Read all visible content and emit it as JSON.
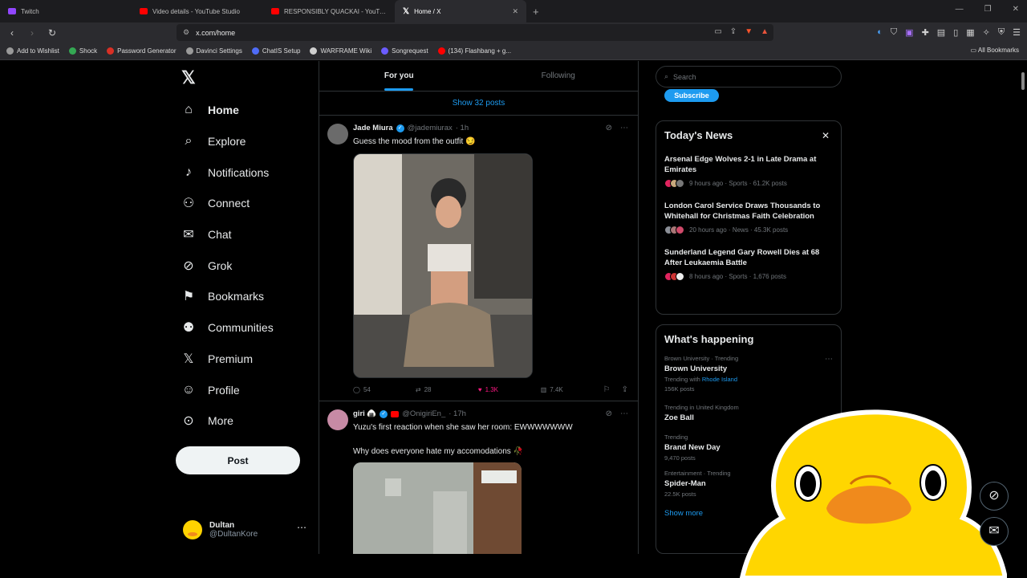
{
  "browser": {
    "tabs": [
      {
        "title": "Twitch",
        "fav_color": "#9146ff",
        "active": false
      },
      {
        "title": "Video details - YouTube Studio",
        "fav_color": "#ff0000",
        "active": false
      },
      {
        "title": "RESPONSIBLY QUACKAI - YouTube",
        "fav_color": "#ff0000",
        "active": false
      },
      {
        "title": "Home / X",
        "fav_color": "#ffffff",
        "active": true
      }
    ],
    "url": "x.com/home",
    "bookmarks": [
      {
        "label": "Add to Wishlist",
        "color": "#9a9a9a"
      },
      {
        "label": "Shock",
        "color": "#34a853"
      },
      {
        "label": "Password Generator",
        "color": "#d93025"
      },
      {
        "label": "Davinci Settings",
        "color": "#9a9a9a"
      },
      {
        "label": "ChatIS Setup",
        "color": "#4f6cf7"
      },
      {
        "label": "WARFRAME Wiki",
        "color": "#cfcfcf"
      },
      {
        "label": "Songrequest",
        "color": "#6b5cff"
      },
      {
        "label": "(134) Flashbang + g...",
        "color": "#ff0000"
      }
    ],
    "all_bookmarks": "All Bookmarks"
  },
  "x": {
    "logo": "X",
    "nav": [
      {
        "label": "Home",
        "icon": "home-icon",
        "glyph": "⌂",
        "bold": true
      },
      {
        "label": "Explore",
        "icon": "search-icon",
        "glyph": "⌕"
      },
      {
        "label": "Notifications",
        "icon": "bell-icon",
        "glyph": "🔔"
      },
      {
        "label": "Connect",
        "icon": "person-add-icon",
        "glyph": "⚇"
      },
      {
        "label": "Chat",
        "icon": "mail-icon",
        "glyph": "✉"
      },
      {
        "label": "Grok",
        "icon": "grok-icon",
        "glyph": "⊘"
      },
      {
        "label": "Bookmarks",
        "icon": "bookmark-icon",
        "glyph": "⚑"
      },
      {
        "label": "Communities",
        "icon": "communities-icon",
        "glyph": "⚉"
      },
      {
        "label": "Premium",
        "icon": "x-premium-icon",
        "glyph": "𝕏"
      },
      {
        "label": "Profile",
        "icon": "profile-icon",
        "glyph": "☺"
      },
      {
        "label": "More",
        "icon": "more-circle-icon",
        "glyph": "⋯"
      }
    ],
    "post_button": "Post",
    "account": {
      "name": "Dultan",
      "handle": "@DultanKore"
    }
  },
  "feed": {
    "tabs": [
      "For you",
      "Following"
    ],
    "show_posts": "Show 32 posts",
    "tweets": [
      {
        "name": "Jade Miura",
        "handle": "@jademiurax",
        "time": "· 1h",
        "text": "Guess the mood from the outfit 😏",
        "replies": "54",
        "reposts": "28",
        "likes": "1.3K",
        "views": "7.4K"
      },
      {
        "name": "giri 🍙",
        "handle": "@OnigiriEn_",
        "time": "· 17h",
        "text": "Yuzu's first reaction when she saw her room: EWWWWWWW",
        "text2": "Why does everyone hate my accomodations 🥀"
      }
    ]
  },
  "sidebar": {
    "search_placeholder": "Search",
    "subscribe": "Subscribe",
    "news_title": "Today's News",
    "news": [
      {
        "headline": "Arsenal Edge Wolves 2-1 in Late Drama at Emirates",
        "meta": "9 hours ago · Sports · 61.2K posts"
      },
      {
        "headline": "London Carol Service Draws Thousands to Whitehall for Christmas Faith Celebration",
        "meta": "20 hours ago · News · 45.3K posts"
      },
      {
        "headline": "Sunderland Legend Gary Rowell Dies at 68 After Leukaemia Battle",
        "meta": "8 hours ago · Sports · 1,676 posts"
      }
    ],
    "happening_title": "What's happening",
    "trends": [
      {
        "meta": "Brown University · Trending",
        "name": "Brown University",
        "sub_prefix": "Trending with ",
        "sub_link": "Rhode Island",
        "count": "156K posts"
      },
      {
        "meta": "Trending in United Kingdom",
        "name": "Zoe Ball",
        "count": ""
      },
      {
        "meta": "Trending",
        "name": "Brand New Day",
        "count": "9,470 posts"
      },
      {
        "meta": "Entertainment · Trending",
        "name": "Spider-Man",
        "count": "22.5K posts"
      }
    ],
    "show_more": "Show more"
  }
}
